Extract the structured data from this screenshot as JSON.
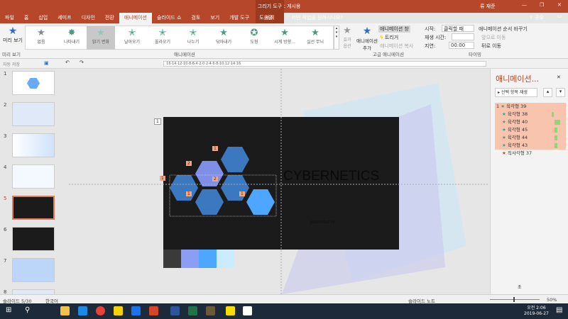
{
  "title": "cybernetic 게시용",
  "context_tool": "그리기 도구",
  "context_tab": "서식",
  "user": "류 재준",
  "tabs": [
    "파일",
    "홈",
    "삽입",
    "세미프",
    "디자인",
    "전환",
    "애니메이션",
    "슬라이드 쇼",
    "검토",
    "보기",
    "개발 도구",
    "도움말"
  ],
  "tell_me": "어떤 작업을 원하시나요?",
  "share": "공유",
  "preview": {
    "label": "미리 보기",
    "group": "미리 보기"
  },
  "effects": [
    "없음",
    "나타내기",
    "밝기 변화",
    "날아오기",
    "올라오기",
    "나누기",
    "닦아내기",
    "도형",
    "시계 방향...",
    "실선 무늬"
  ],
  "effect_options": "효과 옵션",
  "group_animation": "애니메이션",
  "add_animation": "애니메이션 추가",
  "advanced": {
    "pane": "애니메이션 창",
    "trigger": "트리거",
    "painter": "애니메이션 복사",
    "group": "고급 애니메이션"
  },
  "timing": {
    "start_label": "시작:",
    "start_value": "클릭할 때",
    "duration_label": "재생 시간:",
    "duration_value": "",
    "delay_label": "지연:",
    "delay_value": "00.00",
    "reorder": "애니메이션 순서 바꾸기",
    "earlier": "앞으로 이동",
    "later": "뒤로 이동",
    "group": "타이밍"
  },
  "autosave": "자동 저장",
  "slides": [
    "1",
    "2",
    "3",
    "4",
    "5",
    "6",
    "7",
    "8"
  ],
  "slide": {
    "title": "CYBERNETICS",
    "subtitle": "presented by",
    "tags": [
      "1",
      "1",
      "2",
      "2",
      "1",
      "1",
      "1"
    ]
  },
  "pane": {
    "title": "애니메이션...",
    "play": "선택 항목 재생",
    "items": [
      {
        "n": "1",
        "name": "육각형 39"
      },
      {
        "n": "",
        "name": "육각형 38"
      },
      {
        "n": "",
        "name": "육각형 40"
      },
      {
        "n": "",
        "name": "육각형 45"
      },
      {
        "n": "",
        "name": "육각형 44"
      },
      {
        "n": "",
        "name": "육각형 43"
      },
      {
        "n": "",
        "name": "직사각형 37"
      }
    ],
    "seconds": "초"
  },
  "status": {
    "slide": "슬라이드 5/30",
    "lang": "한국어",
    "notes": "슬라이드 노트",
    "zoom": "50%"
  },
  "clock": {
    "time": "오전 2:06",
    "date": "2019-06-27"
  },
  "colors": {
    "accent": "#b7472a",
    "slide_bg": "#1b1b1b",
    "swatches": [
      "#3a3a3a",
      "#8a9ef5",
      "#4da6ff",
      "#c9ecff"
    ]
  }
}
